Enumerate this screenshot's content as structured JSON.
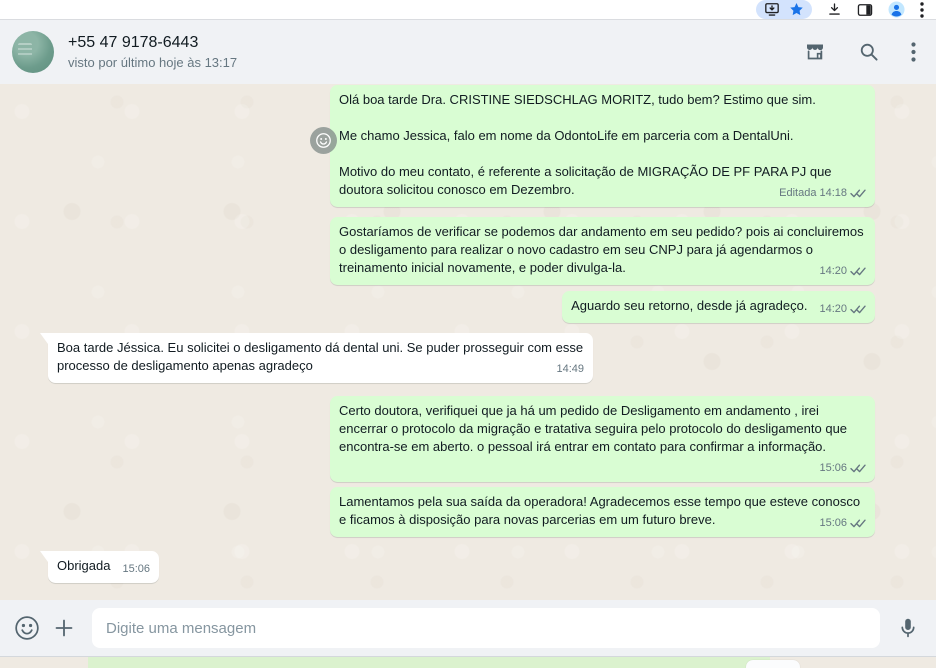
{
  "browser": {
    "icons": [
      "install-app-icon",
      "bookmark-star-icon",
      "download-icon",
      "side-panel-icon",
      "browser-profile-icon",
      "browser-menu-icon"
    ],
    "bookmark_star_color": "#1a73e8",
    "pill_color": "#d3e3fd"
  },
  "chat_header": {
    "title": "+55 47 9178-6443",
    "subtitle": "visto por último hoje às 13:17",
    "icons": [
      "storefront-icon",
      "search-icon",
      "kebab-menu-icon"
    ]
  },
  "messages": [
    {
      "direction": "out",
      "paragraphs": [
        "Olá boa tarde Dra. CRISTINE SIEDSCHLAG MORITZ, tudo bem? Estimo que sim.",
        "Me chamo Jessica, falo em nome da OdontoLife em parceria com a DentalUni.",
        "Motivo do meu contato, é referente a solicitação de MIGRAÇÃO DE PF PARA PJ que doutora solicitou conosco em Dezembro."
      ],
      "edited_label": "Editada",
      "time": "14:18",
      "status": "delivered"
    },
    {
      "direction": "out",
      "text": "Gostaríamos de verificar se podemos dar andamento em seu pedido? pois ai concluiremos o desligamento para realizar o novo cadastro em seu CNPJ para já agendarmos o treinamento inicial novamente, e poder divulga-la.",
      "time": "14:20",
      "status": "delivered"
    },
    {
      "direction": "out",
      "text": "Aguardo seu retorno, desde já agradeço.",
      "time": "14:20",
      "status": "delivered"
    },
    {
      "direction": "in",
      "text": "Boa tarde Jéssica. Eu solicitei o desligamento dá dental uni. Se puder prosseguir com esse processo de desligamento apenas agradeço",
      "time": "14:49"
    },
    {
      "direction": "out",
      "text": "Certo doutora, verifiquei que ja há um pedido de Desligamento em andamento , irei encerrar o protocolo da migração e tratativa seguira pelo protocolo do desligamento que encontra-se em aberto. o pessoal irá entrar em contato para confirmar a informação.",
      "time": "15:06",
      "status": "delivered"
    },
    {
      "direction": "out",
      "text": "Lamentamos pela sua saída da operadora! Agradecemos esse tempo que esteve conosco e ficamos à disposição para novas parcerias em um futuro breve.",
      "time": "15:06",
      "status": "delivered"
    },
    {
      "direction": "in",
      "text": "Obrigada",
      "time": "15:06"
    }
  ],
  "composer": {
    "placeholder": "Digite uma mensagem",
    "icons": [
      "emoji-icon",
      "attach-plus-icon",
      "mic-icon"
    ]
  },
  "colors": {
    "outgoing_bubble": "#d9fdd3",
    "incoming_bubble": "#ffffff",
    "chat_background": "#efeae2",
    "panel_background": "#f0f2f5",
    "icon": "#54656f",
    "meta_text": "#667781",
    "title_text": "#111b21"
  }
}
